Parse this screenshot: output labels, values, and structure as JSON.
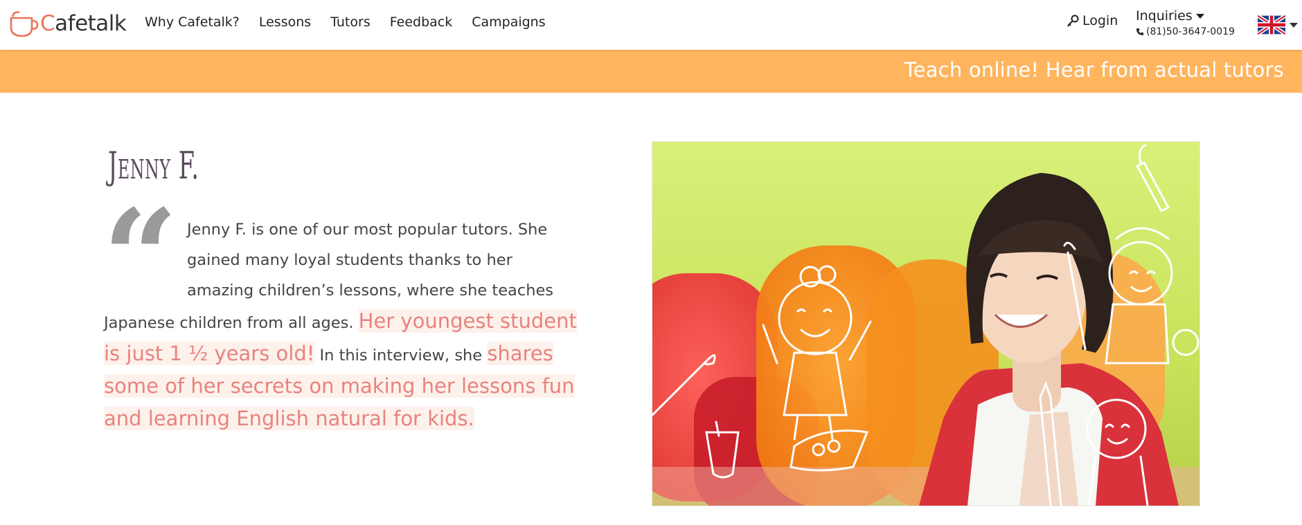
{
  "header": {
    "logo": {
      "lead": "C",
      "rest": "afetalk"
    },
    "nav": [
      "Why Cafetalk?",
      "Lessons",
      "Tutors",
      "Feedback",
      "Campaigns"
    ],
    "login_label": "Login",
    "inquiries_label": "Inquiries",
    "phone": "(81)50-3647-0019",
    "language_flag": "uk-flag-icon"
  },
  "banner": {
    "text": "Teach online! Hear from actual tutors"
  },
  "article": {
    "tutor_name": "Jenny F.",
    "quote_mark": "“",
    "intro_part1": "Jenny F. is one of our most popular tutors. She gained many loyal students thanks to her amazing children’s lessons, where she teaches Japanese children from all ages. ",
    "highlight1": "Her youngest student is just 1 ½ years old!",
    "intro_part2": " In this interview, she ",
    "highlight2": "shares some of her secrets on making her lessons fun and learning English natural for kids."
  },
  "colors": {
    "accent": "#e8735a",
    "banner": "#ffb45e",
    "highlight_text": "#e8837c",
    "highlight_bg": "#fdf1ec"
  }
}
